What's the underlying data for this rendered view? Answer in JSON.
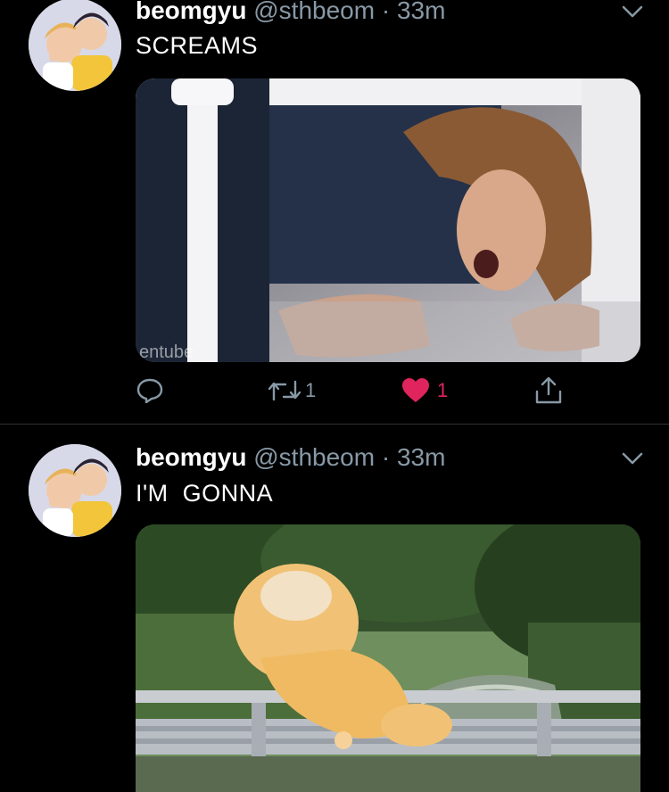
{
  "tweets": [
    {
      "name": "beomgyu",
      "handle": "@sthbeom",
      "time": "· 33m",
      "text": "SCREAMS",
      "media_watermark": "entube",
      "retweets": "1",
      "likes": "1",
      "liked": true
    },
    {
      "name": "beomgyu",
      "handle": "@sthbeom",
      "time": "· 33m",
      "text": "I'M  GONNA"
    }
  ],
  "colors": {
    "background": "#000000",
    "secondary_text": "#8899a6",
    "like": "#e0245e",
    "divider": "#2f3336"
  },
  "icons": [
    "chevron-down-icon",
    "reply-icon",
    "retweet-icon",
    "heart-icon",
    "share-icon"
  ]
}
